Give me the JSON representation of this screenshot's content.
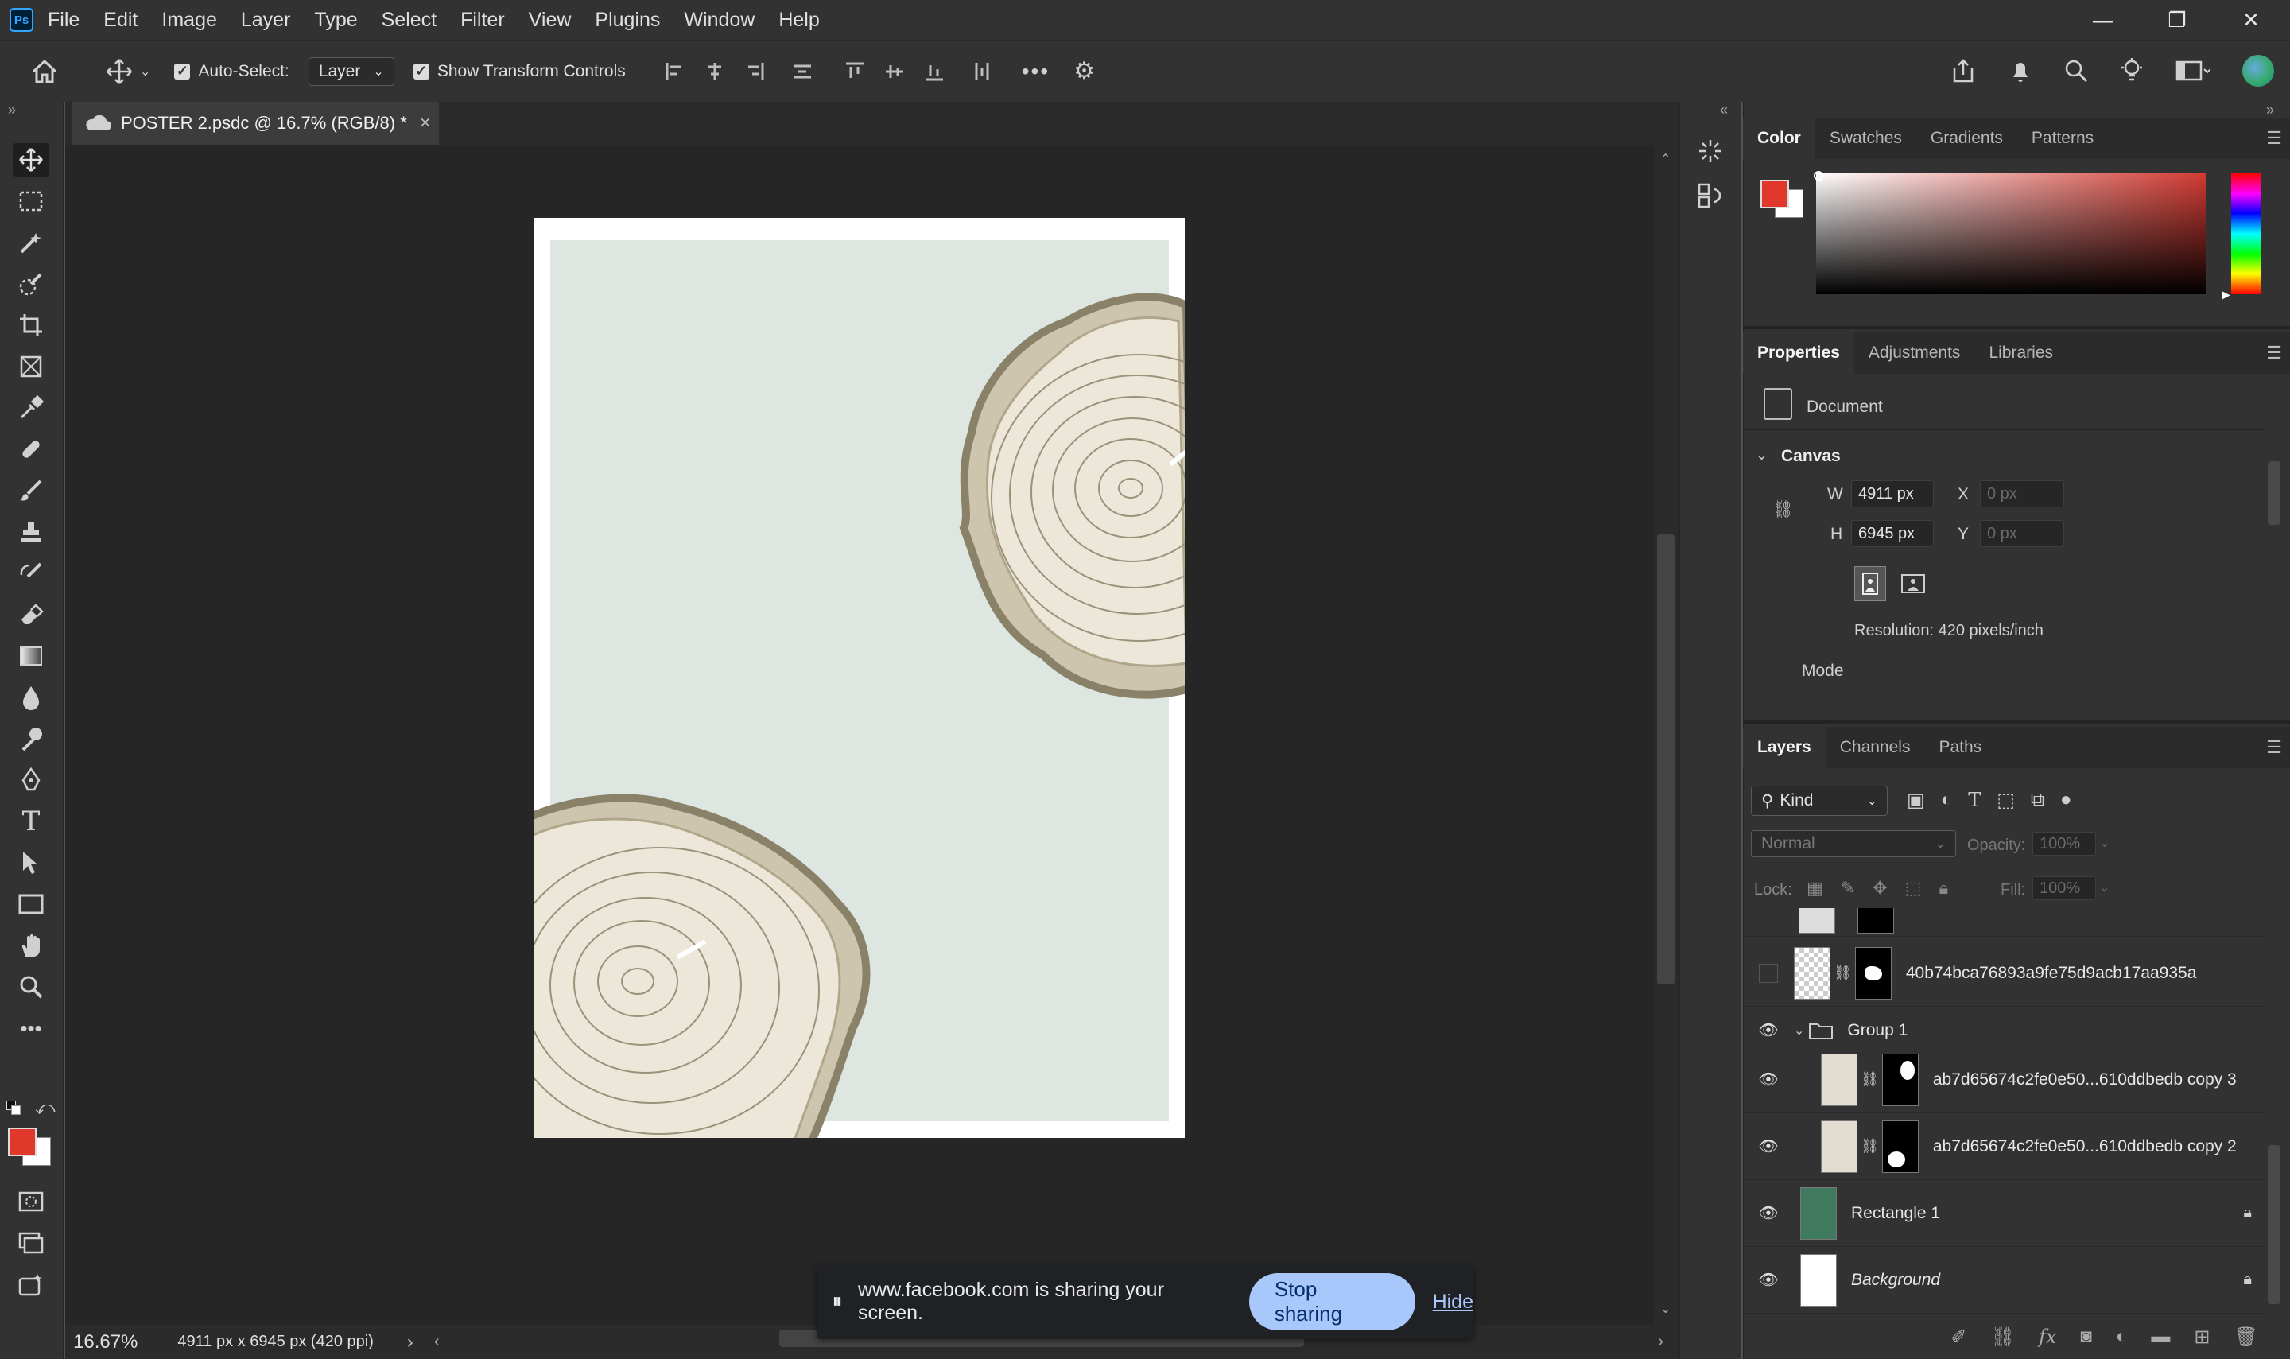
{
  "app": {
    "logo": "Ps"
  },
  "menu": [
    "File",
    "Edit",
    "Image",
    "Layer",
    "Type",
    "Select",
    "Filter",
    "View",
    "Plugins",
    "Window",
    "Help"
  ],
  "window_controls": {
    "minimize": "—",
    "restore": "❐",
    "close": "✕"
  },
  "options": {
    "auto_select_label": "Auto-Select:",
    "auto_select_target": "Layer",
    "show_transform_label": "Show Transform Controls"
  },
  "document": {
    "tab_title": "POSTER 2.psdc @ 16.7% (RGB/8) *",
    "close_glyph": "×"
  },
  "status": {
    "zoom": "16.67%",
    "doc_info": "4911 px x 6945 px (420 ppi)",
    "arrow": "›"
  },
  "share_notice": {
    "text": "www.facebook.com is sharing your screen.",
    "stop_label": "Stop sharing",
    "hide_label": "Hide"
  },
  "color_panel": {
    "tabs": [
      "Color",
      "Swatches",
      "Gradients",
      "Patterns"
    ],
    "foreground": "#e0392c",
    "background": "#ffffff"
  },
  "properties_panel": {
    "tabs": [
      "Properties",
      "Adjustments",
      "Libraries"
    ],
    "document_label": "Document",
    "canvas_label": "Canvas",
    "w_label": "W",
    "w_value": "4911 px",
    "h_label": "H",
    "h_value": "6945 px",
    "x_label": "X",
    "x_placeholder": "0 px",
    "y_label": "Y",
    "y_placeholder": "0 px",
    "resolution": "Resolution: 420 pixels/inch",
    "mode_label": "Mode"
  },
  "layers_panel": {
    "tabs": [
      "Layers",
      "Channels",
      "Paths"
    ],
    "filter_kind": "Kind",
    "blend_mode": "Normal",
    "opacity_label": "Opacity:",
    "opacity_value": "100%",
    "lock_label": "Lock:",
    "fill_label": "Fill:",
    "fill_value": "100%",
    "layers": [
      {
        "name": "40b74bca76893a9fe75d9acb17aa935a",
        "visible": false
      },
      {
        "name": "Group 1",
        "visible": true
      },
      {
        "name": "ab7d65674c2fe0e50...610ddbedb copy 3",
        "visible": true
      },
      {
        "name": "ab7d65674c2fe0e50...610ddbedb copy 2",
        "visible": true
      },
      {
        "name": "Rectangle 1",
        "visible": true,
        "locked": true
      },
      {
        "name": "Background",
        "visible": true,
        "locked": true
      }
    ]
  },
  "colors": {
    "app_bg": "#323232",
    "canvas_mint": "#dde6e1",
    "rect_layer_green": "#3f7a5f",
    "accent_blue": "#a8c7fa"
  }
}
